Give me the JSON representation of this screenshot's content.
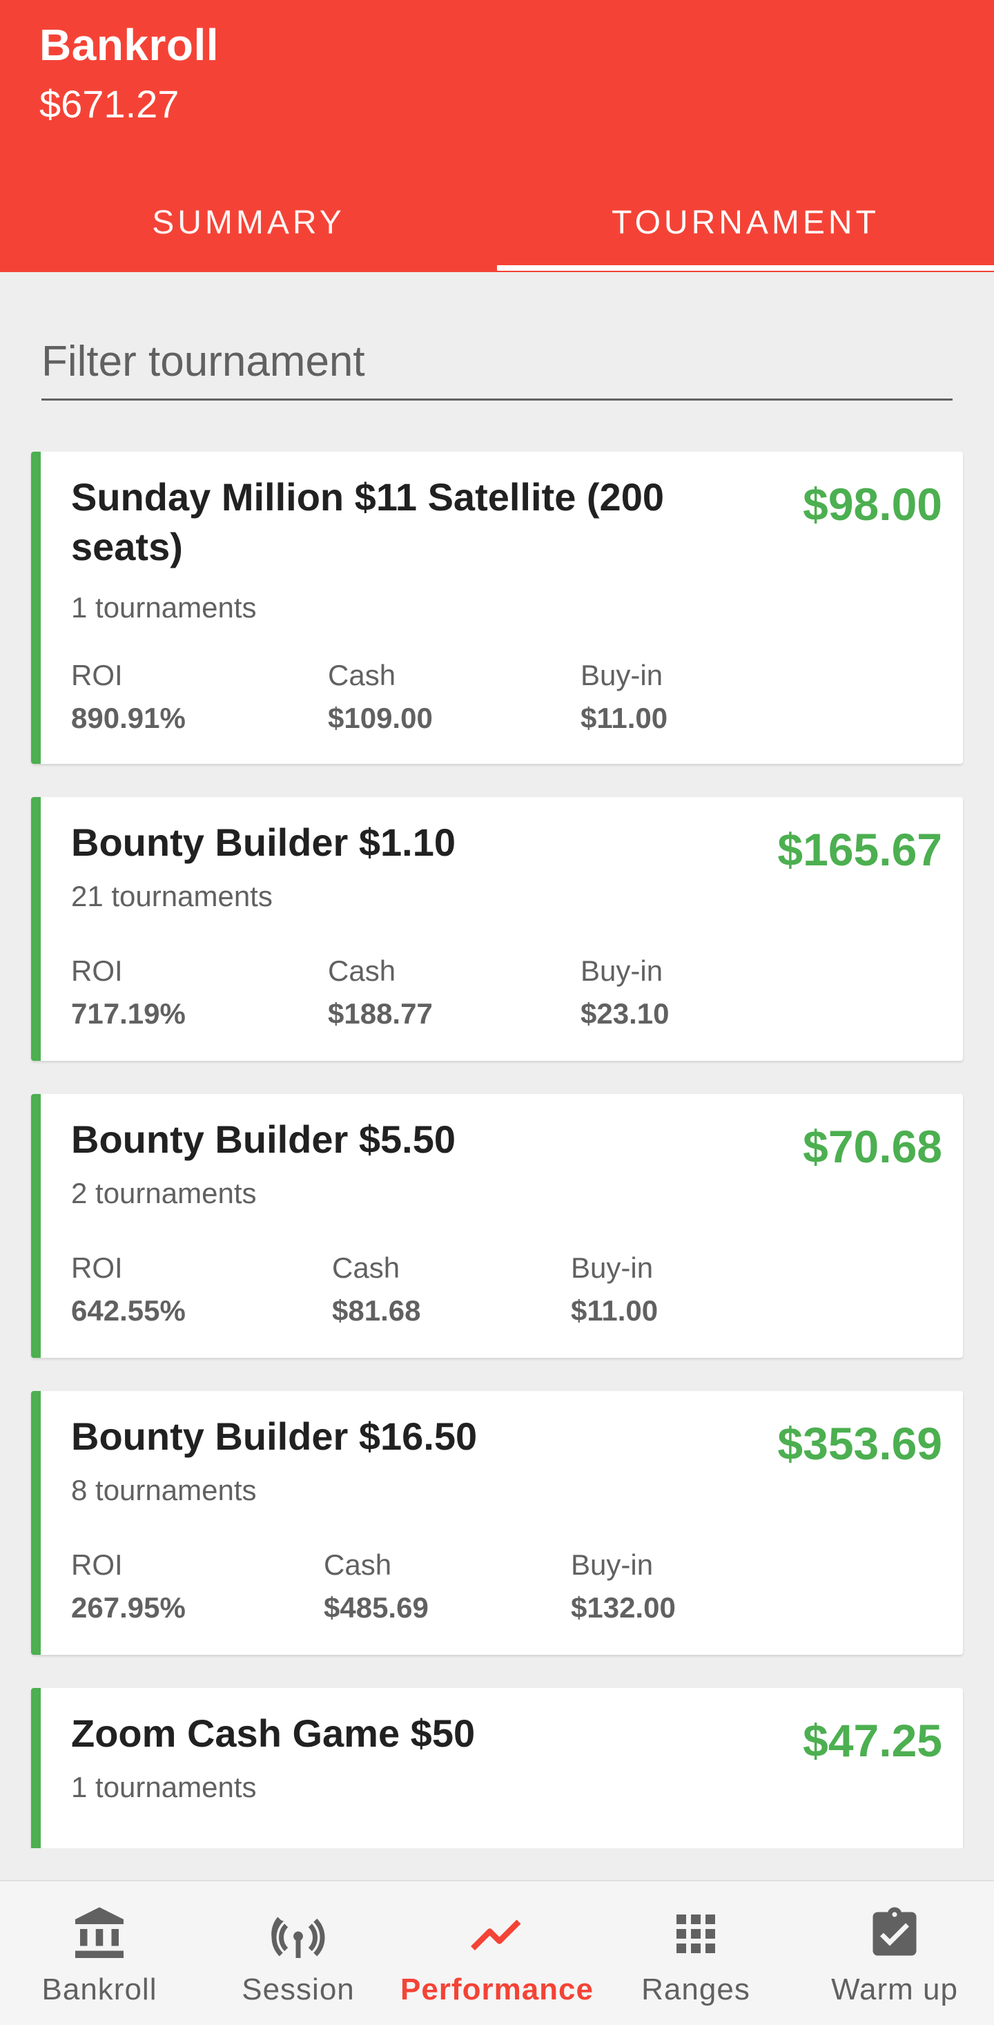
{
  "header": {
    "title": "Bankroll",
    "amount": "$671.27",
    "tabs": [
      {
        "label": "SUMMARY",
        "active": false
      },
      {
        "label": "TOURNAMENT",
        "active": true
      }
    ]
  },
  "filter": {
    "placeholder": "Filter tournament"
  },
  "stat_labels": {
    "roi": "ROI",
    "cash": "Cash",
    "buyin": "Buy-in"
  },
  "tournaments": [
    {
      "name": "Sunday Million $11 Satellite (200 seats)",
      "count": "1 tournaments",
      "profit": "$98.00",
      "roi": "890.91%",
      "cash": "$109.00",
      "buyin": "$11.00"
    },
    {
      "name": "Bounty Builder $1.10",
      "count": "21 tournaments",
      "profit": "$165.67",
      "roi": "717.19%",
      "cash": "$188.77",
      "buyin": "$23.10"
    },
    {
      "name": "Bounty Builder $5.50",
      "count": "2 tournaments",
      "profit": "$70.68",
      "roi": "642.55%",
      "cash": "$81.68",
      "buyin": "$11.00"
    },
    {
      "name": "Bounty Builder $16.50",
      "count": "8 tournaments",
      "profit": "$353.69",
      "roi": "267.95%",
      "cash": "$485.69",
      "buyin": "$132.00"
    },
    {
      "name": "Zoom Cash Game $50",
      "count": "1 tournaments",
      "profit": "$47.25",
      "roi": "",
      "cash": "",
      "buyin": ""
    }
  ],
  "colors": {
    "primary": "#f44336",
    "profit": "#4caf50",
    "background": "#eeeeee",
    "secondary_text": "#616161"
  },
  "bottom_nav": [
    {
      "label": "Bankroll",
      "icon": "bank-icon",
      "active": false
    },
    {
      "label": "Session",
      "icon": "broadcast-icon",
      "active": false
    },
    {
      "label": "Performance",
      "icon": "trending-up-icon",
      "active": true
    },
    {
      "label": "Ranges",
      "icon": "grid-icon",
      "active": false
    },
    {
      "label": "Warm up",
      "icon": "clipboard-check-icon",
      "active": false
    }
  ]
}
